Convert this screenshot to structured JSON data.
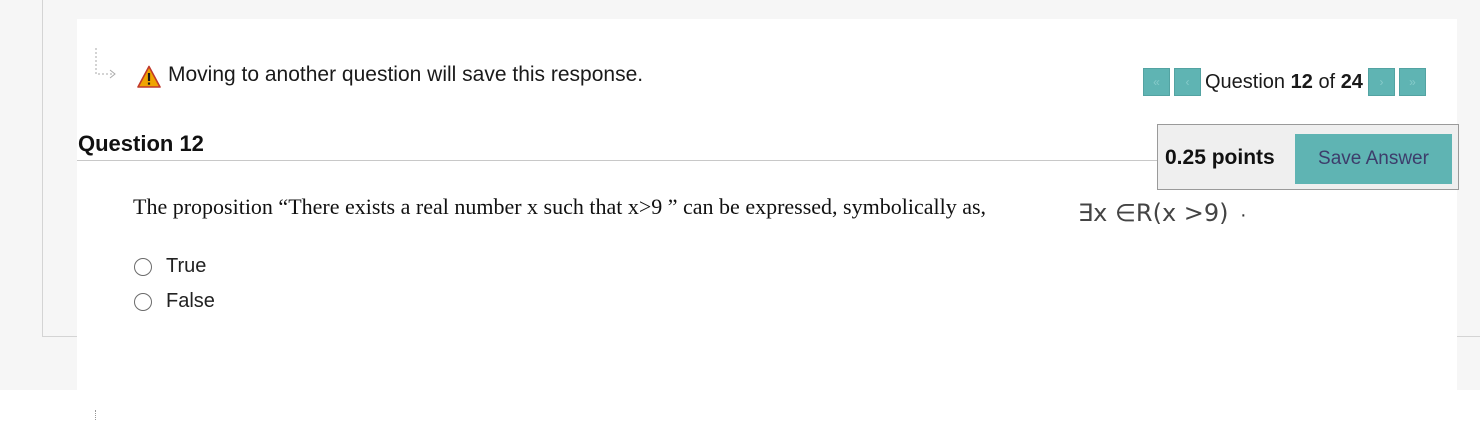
{
  "notice": {
    "message": "Moving to another question will save this response.",
    "icon": "warning-icon",
    "icon_color": "#f0a400"
  },
  "navigation": {
    "prefix": "Question",
    "current": "12",
    "separator": "of",
    "total": "24",
    "first_label": "«",
    "prev_label": "‹",
    "next_label": "›",
    "last_label": "»"
  },
  "question": {
    "title": "Question 12",
    "points": "0.25 points",
    "save_label": "Save Answer",
    "prompt": "The proposition “There exists a real number x  such that x>9 ” can be expressed, symbolically as,",
    "expression": "∃x ∈R(x >9)",
    "trailing": "·",
    "options": [
      {
        "label": "True"
      },
      {
        "label": "False"
      }
    ]
  },
  "colors": {
    "accent": "#5fb4b3",
    "save_text": "#3d3d6b",
    "points_bg": "#efefef"
  }
}
